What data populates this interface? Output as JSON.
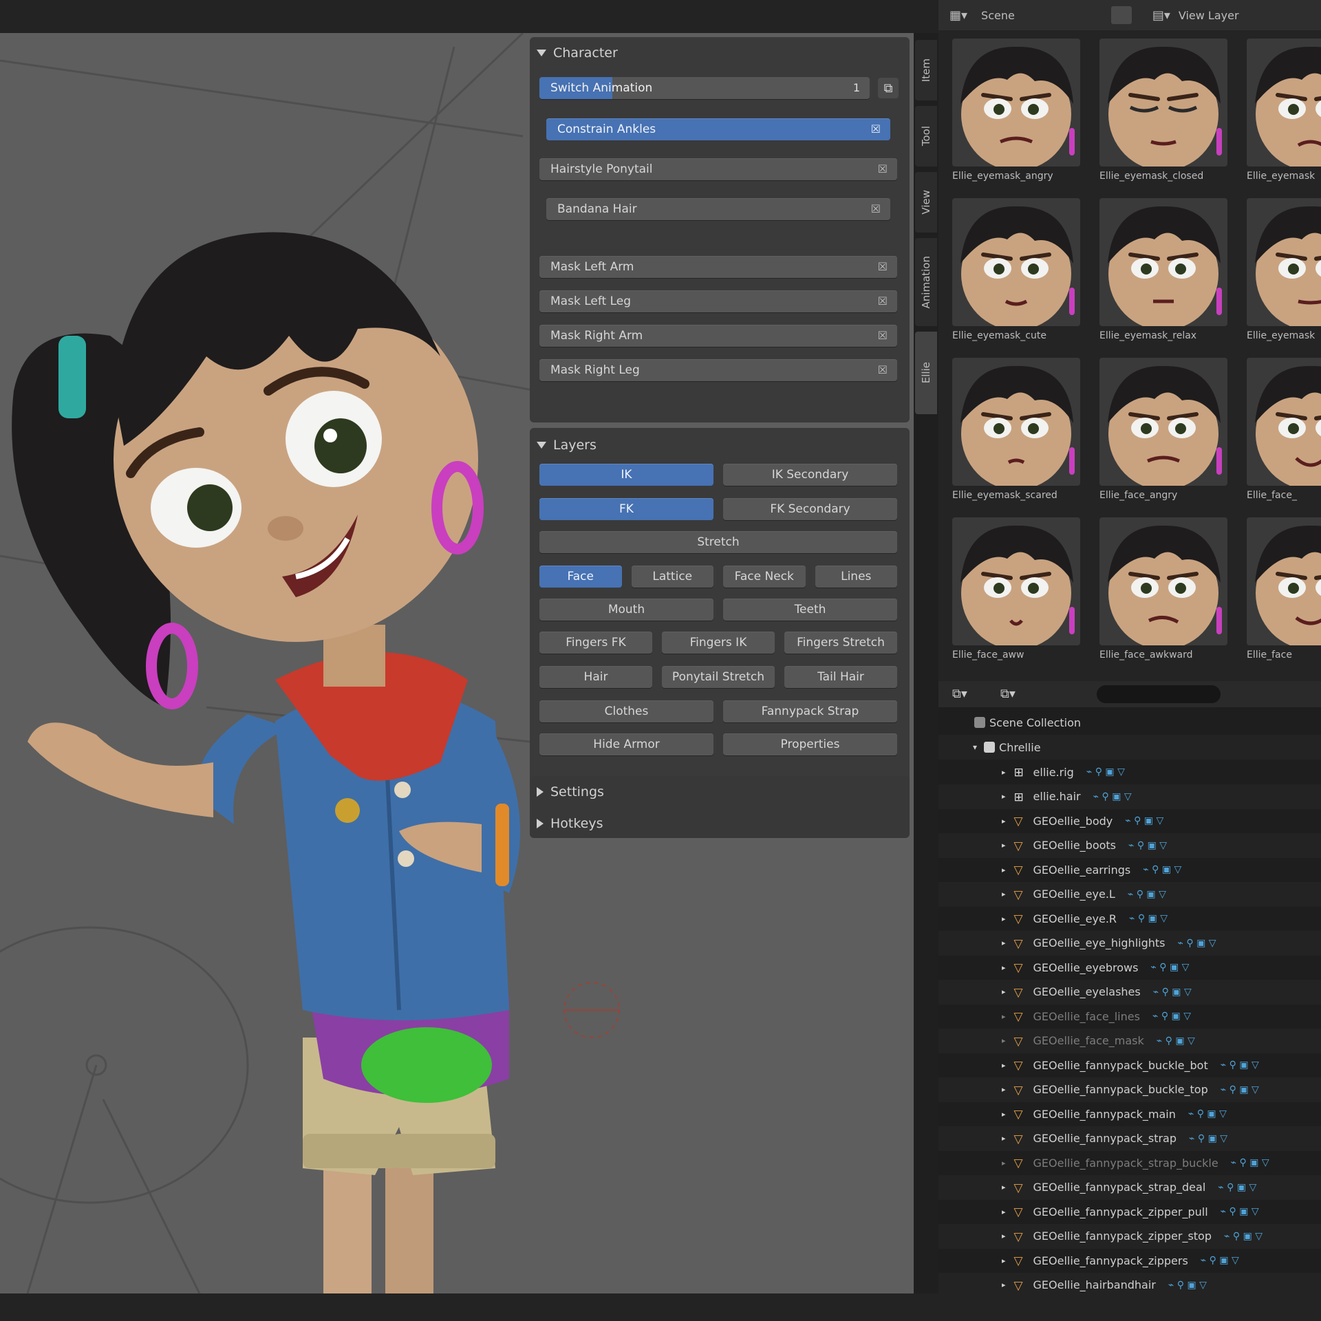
{
  "header": {
    "scene_label": "Scene",
    "view_layer_label": "View Layer"
  },
  "character_panel": {
    "title": "Character",
    "switch_slider": {
      "label": "Switch Animation",
      "value": "1",
      "fraction": 0.22
    },
    "toggles": [
      {
        "label": "Constrain Ankles",
        "active": true
      },
      {
        "label": "Hairstyle Ponytail",
        "active": false
      },
      {
        "label": "Bandana Hair",
        "active": false
      }
    ],
    "masks": [
      {
        "label": "Mask Left Arm"
      },
      {
        "label": "Mask Left Leg"
      },
      {
        "label": "Mask Right Arm"
      },
      {
        "label": "Mask Right Leg"
      }
    ]
  },
  "layers_panel": {
    "title": "Layers",
    "rows": [
      [
        {
          "label": "IK",
          "active": true
        },
        {
          "label": "IK Secondary",
          "active": false
        }
      ],
      [
        {
          "label": "FK",
          "active": true
        },
        {
          "label": "FK Secondary",
          "active": false
        }
      ],
      [
        {
          "label": "Stretch",
          "active": false
        }
      ],
      [
        {
          "label": "Face",
          "active": true
        },
        {
          "label": "Lattice",
          "active": false
        },
        {
          "label": "Face Neck",
          "active": false
        },
        {
          "label": "Lines",
          "active": false
        }
      ],
      [
        {
          "label": "Mouth",
          "active": false
        },
        {
          "label": "Teeth",
          "active": false
        }
      ],
      [
        {
          "label": "Fingers FK",
          "active": false
        },
        {
          "label": "Fingers IK",
          "active": false
        },
        {
          "label": "Fingers Stretch",
          "active": false
        }
      ],
      [
        {
          "label": "Hair",
          "active": false
        },
        {
          "label": "Ponytail Stretch",
          "active": false
        },
        {
          "label": "Tail Hair",
          "active": false
        }
      ],
      [
        {
          "label": "Clothes",
          "active": false
        },
        {
          "label": "Fannypack Strap",
          "active": false
        }
      ],
      [
        {
          "label": "Hide Armor",
          "active": false
        },
        {
          "label": "Properties",
          "active": false
        }
      ]
    ]
  },
  "collapsed_sections": [
    {
      "label": "Settings"
    },
    {
      "label": "Hotkeys"
    }
  ],
  "sidebar_tabs": [
    "Item",
    "Tool",
    "View",
    "Animation",
    "Ellie"
  ],
  "asset_grid": [
    {
      "caption": "Ellie_eyemask_angry",
      "mood": "angry"
    },
    {
      "caption": "Ellie_eyemask_closed",
      "mood": "closed"
    },
    {
      "caption": "Ellie_eyemask",
      "mood": "sad"
    },
    {
      "caption": "Ellie_eyemask_cute",
      "mood": "cute"
    },
    {
      "caption": "Ellie_eyemask_relax",
      "mood": "relax"
    },
    {
      "caption": "Ellie_eyemask",
      "mood": "squint"
    },
    {
      "caption": "Ellie_eyemask_scared",
      "mood": "scared"
    },
    {
      "caption": "Ellie_face_angry",
      "mood": "angry"
    },
    {
      "caption": "Ellie_face_",
      "mood": "happy"
    },
    {
      "caption": "Ellie_face_aww",
      "mood": "aww"
    },
    {
      "caption": "Ellie_face_awkward",
      "mood": "awkward"
    },
    {
      "caption": "Ellie_face",
      "mood": "smile"
    }
  ],
  "outliner": {
    "scene_collection": "Scene Collection",
    "collection": "Chrellie",
    "rows": [
      {
        "label": "ellie.rig",
        "type": "armature",
        "dim": false
      },
      {
        "label": "ellie.hair",
        "type": "armature",
        "dim": false
      },
      {
        "label": "GEOellie_body",
        "type": "mesh",
        "dim": false
      },
      {
        "label": "GEOellie_boots",
        "type": "mesh",
        "dim": false
      },
      {
        "label": "GEOellie_earrings",
        "type": "mesh",
        "dim": false
      },
      {
        "label": "GEOellie_eye.L",
        "type": "mesh",
        "dim": false
      },
      {
        "label": "GEOellie_eye.R",
        "type": "mesh",
        "dim": false
      },
      {
        "label": "GEOellie_eye_highlights",
        "type": "mesh",
        "dim": false
      },
      {
        "label": "GEOellie_eyebrows",
        "type": "mesh",
        "dim": false
      },
      {
        "label": "GEOellie_eyelashes",
        "type": "mesh",
        "dim": false
      },
      {
        "label": "GEOellie_face_lines",
        "type": "mesh",
        "dim": true
      },
      {
        "label": "GEOellie_face_mask",
        "type": "mesh",
        "dim": true
      },
      {
        "label": "GEOellie_fannypack_buckle_bot",
        "type": "mesh",
        "dim": false
      },
      {
        "label": "GEOellie_fannypack_buckle_top",
        "type": "mesh",
        "dim": false
      },
      {
        "label": "GEOellie_fannypack_main",
        "type": "mesh",
        "dim": false
      },
      {
        "label": "GEOellie_fannypack_strap",
        "type": "mesh",
        "dim": false
      },
      {
        "label": "GEOellie_fannypack_strap_buckle",
        "type": "mesh",
        "dim": true
      },
      {
        "label": "GEOellie_fannypack_strap_deal",
        "type": "mesh",
        "dim": false
      },
      {
        "label": "GEOellie_fannypack_zipper_pull",
        "type": "mesh",
        "dim": false
      },
      {
        "label": "GEOellie_fannypack_zipper_stop",
        "type": "mesh",
        "dim": false
      },
      {
        "label": "GEOellie_fannypack_zippers",
        "type": "mesh",
        "dim": false
      },
      {
        "label": "GEOellie_hairbandhair",
        "type": "mesh",
        "dim": false
      }
    ]
  },
  "colors": {
    "accent": "#4772b3",
    "viewport": "#5e5e5e",
    "panel": "#3a3a3a",
    "mesh_icon": "#e8a34a"
  }
}
